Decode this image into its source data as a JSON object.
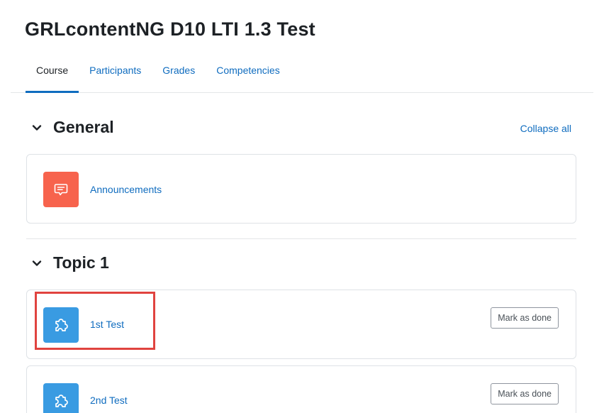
{
  "course": {
    "title": "GRLcontentNG D10 LTI 1.3 Test"
  },
  "tabs": [
    {
      "label": "Course",
      "active": true
    },
    {
      "label": "Participants",
      "active": false
    },
    {
      "label": "Grades",
      "active": false
    },
    {
      "label": "Competencies",
      "active": false
    }
  ],
  "collapse_all_label": "Collapse all",
  "sections": [
    {
      "title": "General",
      "activities": [
        {
          "name": "Announcements",
          "icon": "forum-icon",
          "icon_color": "#f7634d"
        }
      ]
    },
    {
      "title": "Topic 1",
      "activities": [
        {
          "name": "1st Test",
          "icon": "puzzle-icon",
          "icon_color": "#399be2",
          "completion_label": "Mark as done"
        },
        {
          "name": "2nd Test",
          "icon": "puzzle-icon",
          "icon_color": "#399be2",
          "completion_label": "Mark as done"
        }
      ]
    }
  ],
  "colors": {
    "link": "#0f6cbf",
    "highlight": "#e0433f"
  }
}
